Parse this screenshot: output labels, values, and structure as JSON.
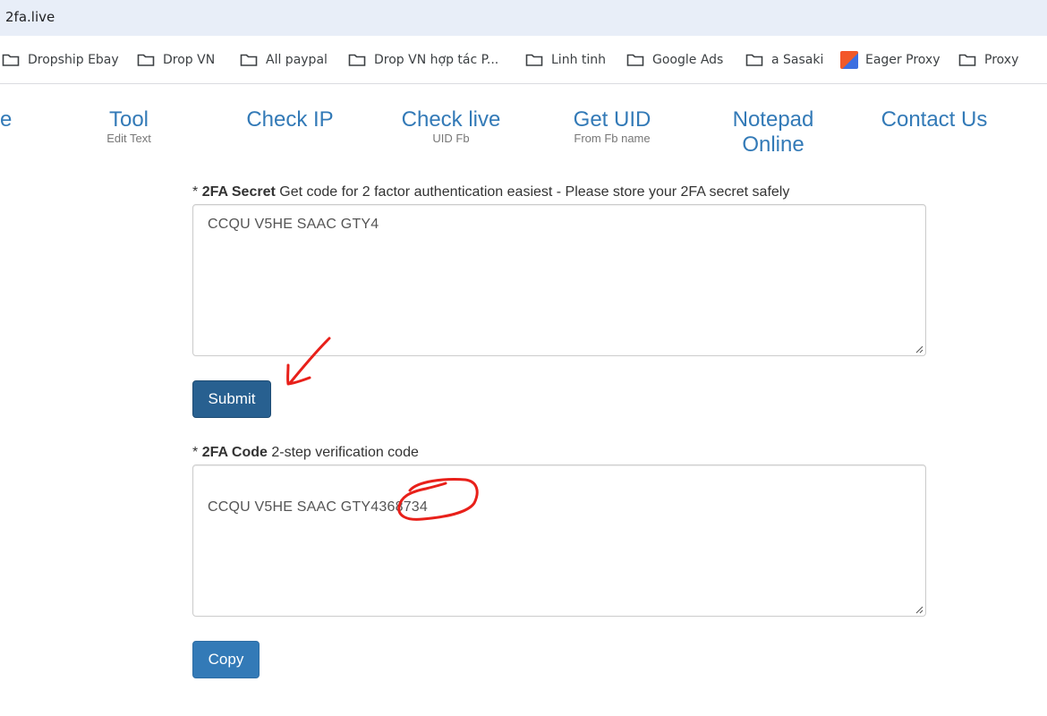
{
  "browser": {
    "url": "2fa.live",
    "bookmarks": [
      {
        "label": "Dropship Ebay",
        "icon": "folder-icon"
      },
      {
        "label": "Drop VN",
        "icon": "folder-icon"
      },
      {
        "label": "All paypal",
        "icon": "folder-icon"
      },
      {
        "label": "Drop VN hợp tác P...",
        "icon": "folder-icon"
      },
      {
        "label": "Linh tinh",
        "icon": "folder-icon"
      },
      {
        "label": "Google Ads",
        "icon": "folder-icon"
      },
      {
        "label": "a Sasaki",
        "icon": "folder-icon"
      },
      {
        "label": "Eager Proxy",
        "icon": "proxy-icon"
      },
      {
        "label": "Proxy",
        "icon": "folder-icon"
      }
    ]
  },
  "nav": {
    "partial": "e",
    "items": [
      {
        "title": "Tool",
        "sub": "Edit Text"
      },
      {
        "title": "Check IP",
        "sub": ""
      },
      {
        "title": "Check live",
        "sub": "UID Fb"
      },
      {
        "title": "Get UID",
        "sub": "From Fb name"
      },
      {
        "title": "Notepad Online",
        "sub": ""
      },
      {
        "title": "Contact Us",
        "sub": ""
      }
    ]
  },
  "form": {
    "secret": {
      "required_mark": "*",
      "label_bold": "2FA Secret",
      "label_text": "Get code for 2 factor authentication easiest - Please store your 2FA secret safely",
      "value": "CCQU V5HE SAAC GTY4"
    },
    "submit_label": "Submit",
    "code": {
      "required_mark": "*",
      "label_bold": "2FA Code",
      "label_text": "2-step verification code",
      "value_prefix": "CCQU V5HE SAAC GTY4",
      "value_code": "368734"
    },
    "copy_label": "Copy"
  },
  "colors": {
    "link": "#337ab7",
    "submit_bg": "#286090",
    "copy_bg": "#337ab7",
    "annotation": "#e8201a"
  }
}
